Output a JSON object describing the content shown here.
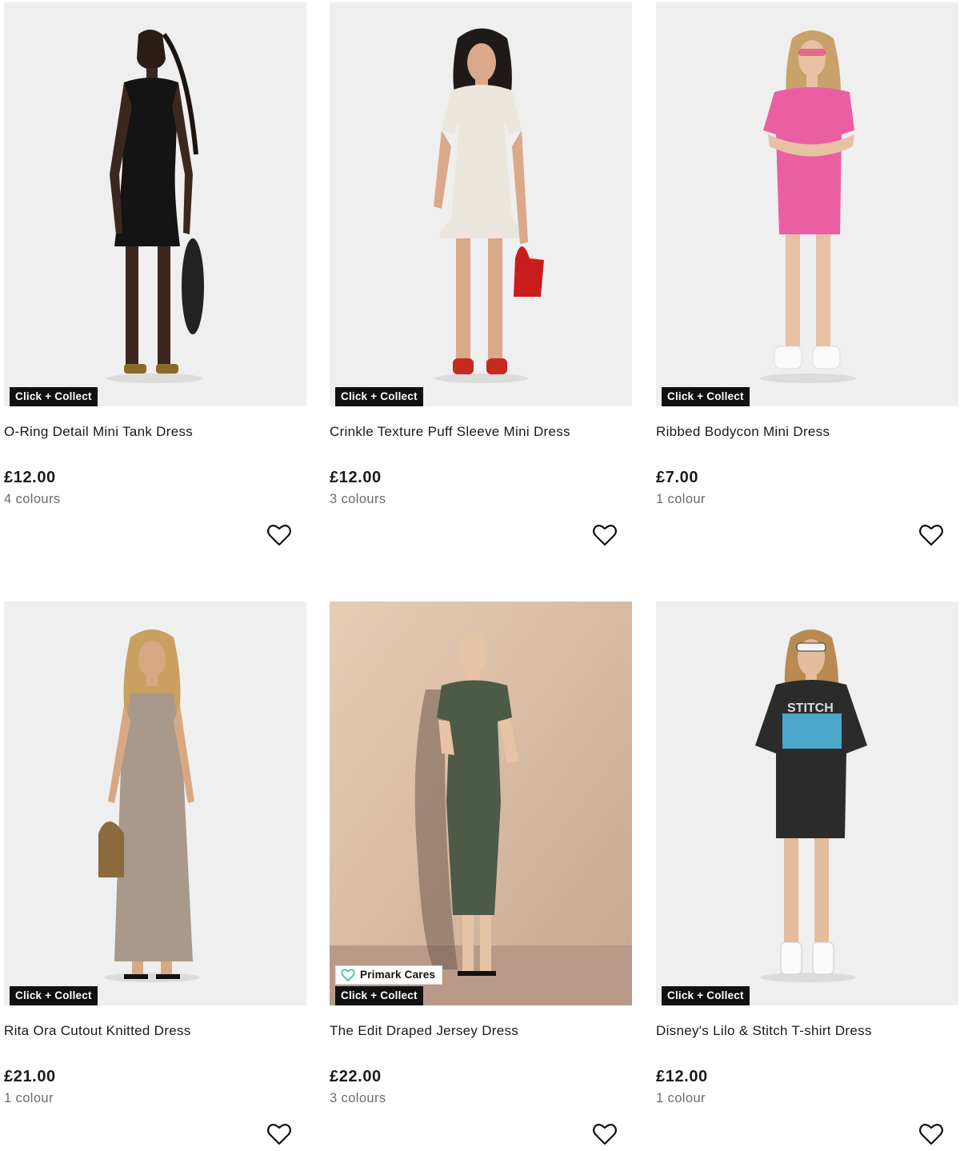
{
  "badges": {
    "click_collect": "Click + Collect",
    "primark_cares": "Primark Cares"
  },
  "icons": {
    "favourite": "heart-outline-icon",
    "cares": "heart-leaf-icon"
  },
  "colors": {
    "badge_bg": "#111111",
    "cares_icon": "#3fb5a7",
    "muted_text": "#6b6b6b"
  },
  "products": [
    {
      "name": "O-Ring Detail Mini Tank Dress",
      "price": "£12.00",
      "colours": "4 colours",
      "click_collect": true,
      "primark_cares": false
    },
    {
      "name": "Crinkle Texture Puff Sleeve Mini Dress",
      "price": "£12.00",
      "colours": "3 colours",
      "click_collect": true,
      "primark_cares": false
    },
    {
      "name": "Ribbed Bodycon Mini Dress",
      "price": "£7.00",
      "colours": "1 colour",
      "click_collect": true,
      "primark_cares": false
    },
    {
      "name": "Rita Ora Cutout Knitted Dress",
      "price": "£21.00",
      "colours": "1 colour",
      "click_collect": true,
      "primark_cares": false
    },
    {
      "name": "The Edit Draped Jersey Dress",
      "price": "£22.00",
      "colours": "3 colours",
      "click_collect": true,
      "primark_cares": true
    },
    {
      "name": "Disney's Lilo & Stitch T-shirt Dress",
      "price": "£12.00",
      "colours": "1 colour",
      "click_collect": true,
      "primark_cares": false
    }
  ]
}
